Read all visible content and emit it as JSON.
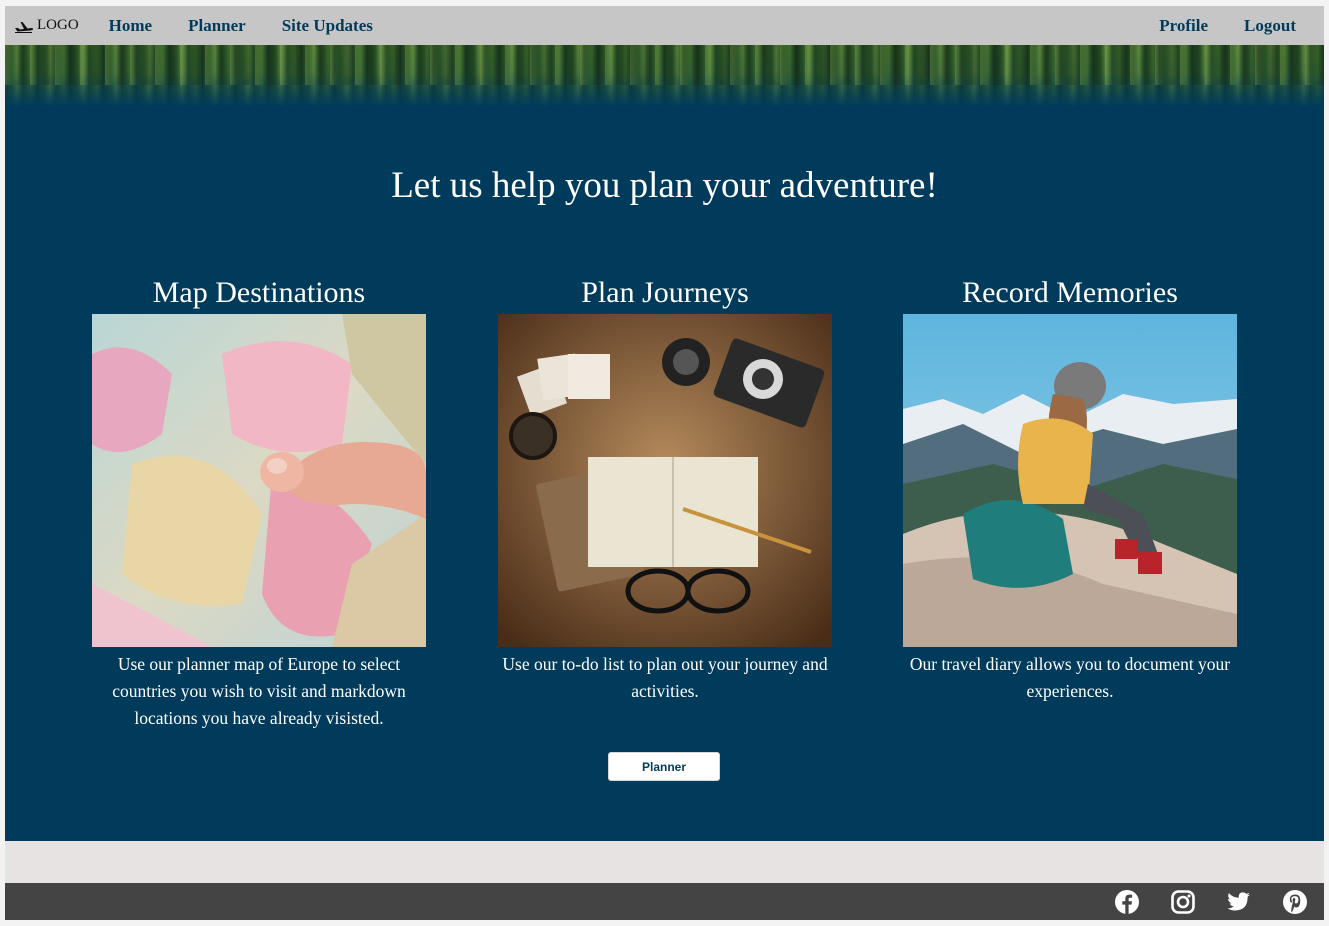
{
  "nav": {
    "logo_text": "LOGO",
    "links": [
      "Home",
      "Planner",
      "Site Updates"
    ],
    "right_links": [
      "Profile",
      "Logout"
    ]
  },
  "hero": {
    "title": "Let us help you plan your adventure!"
  },
  "cards": [
    {
      "title": "Map Destinations",
      "text": "Use our planner map of Europe to select countries you wish to visit and markdown locations you have already visisted.",
      "image": "europe-map-photo"
    },
    {
      "title": "Plan Journeys",
      "text": "Use our to-do list to plan out your journey and activities.",
      "image": "travel-flatlay-photo"
    },
    {
      "title": "Record Memories",
      "text": "Our travel diary allows you to document your experiences.",
      "image": "hiker-mountain-photo"
    }
  ],
  "cta": {
    "label": "Planner"
  },
  "footer": {
    "icons": [
      "facebook-icon",
      "instagram-icon",
      "twitter-icon",
      "pinterest-icon"
    ]
  },
  "colors": {
    "primary": "#003b5c",
    "navbar": "#c6c6c6",
    "footer": "#444444",
    "band": "#e7e3e3"
  }
}
